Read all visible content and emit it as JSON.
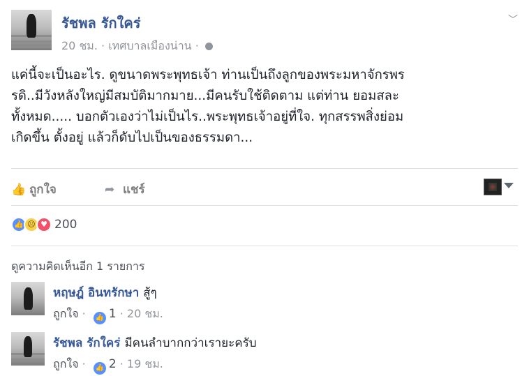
{
  "post": {
    "author": "รัชพล รักใคร่",
    "time": "20 ชม.",
    "location": "เทศบาลเมืองน่าน",
    "lines": [
      "แค่นี้จะเป็นอะไร. ดูขนาดพระพุทธเจ้า ท่านเป็นถึงลูกของพระมหาจักรพร",
      "รดิ..มีวังหลังใหญ่มีสมบัติมากมาย...มีคนรับใช้ติดตาม แต่ท่าน ยอมสละ",
      "ทั้งหมด..... บอกตัวเองว่าไม่เป็นไร..พระพุทธเจ้าอยู่ที่ใจ. ทุกสรรพสิ่งย่อม",
      "เกิดขึ้น ตั้งอยู่ แล้วก็ดับไปเป็นของธรรมดา..."
    ]
  },
  "actions": {
    "like": "ถูกใจ",
    "share": "แชร์"
  },
  "icons": {
    "like": "thumbs-up-icon",
    "share": "share-arrow-icon",
    "globe": "globe-icon",
    "chevron": "chevron-down-icon"
  },
  "reactions": {
    "count": "200",
    "types": [
      "like",
      "sad",
      "love"
    ]
  },
  "more_comments": "ดูความคิดเห็นอีก 1 รายการ",
  "comments": [
    {
      "author": "หฤษฎ์ อินทรักษา",
      "text": "สู้ๆ",
      "like": "ถูกใจ",
      "likes": "1",
      "time": "20 ชม."
    },
    {
      "author": "รัชพล รักใคร่",
      "text": "มีคนลำบากกว่าเรายะครับ",
      "like": "ถูกใจ",
      "likes": "2",
      "time": "19 ชม."
    }
  ],
  "colors": {
    "link": "#365899",
    "muted": "#90949c",
    "like_blue": "#5890ff",
    "love_red": "#f25268",
    "sad_yellow": "#f7d14c"
  }
}
